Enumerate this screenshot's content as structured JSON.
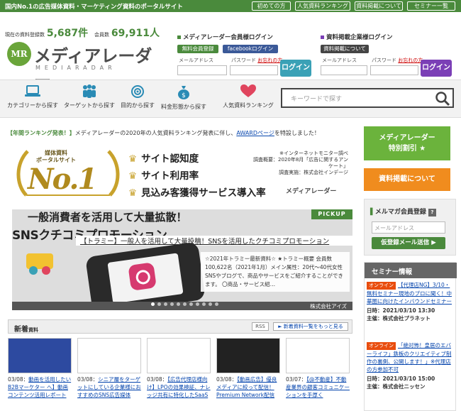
{
  "topbar": {
    "tagline": "国内No.1の広告媒体資料・マーケティング資料のポータルサイト",
    "nav": [
      "初めての方",
      "人気資料ランキング",
      "資料掲載について",
      "セミナー一覧"
    ]
  },
  "header": {
    "count_label_1": "現在の資料登録数",
    "count_value_1": "5,687件",
    "count_label_2": "会員数",
    "count_value_2": "69,911人",
    "logo_mark": "MR",
    "logo_jp": "メディアレーダー",
    "logo_en": "MEDIARADAR"
  },
  "member_login": {
    "title": "メディアレーダー会員様ログイン",
    "register_label": "無料会員登録",
    "facebook_label": "facebookログイン",
    "email_label": "メールアドレス",
    "password_label": "パスワード",
    "forgot_label": "お忘れの方",
    "login_label": "ログイン",
    "accent": "#4a8a3c",
    "button_color": "#3aa1b6"
  },
  "company_login": {
    "title": "資料掲載企業様ログイン",
    "about_label": "資料掲載について",
    "email_label": "メールアドレス",
    "password_label": "パスワード",
    "forgot_label": "お忘れの方",
    "login_label": "ログイン",
    "accent": "#7b3fb6"
  },
  "categories": [
    {
      "label": "カテゴリーから探す",
      "icon": "monitor-icon"
    },
    {
      "label": "ターゲットから探す",
      "icon": "people-icon"
    },
    {
      "label": "目的から探す",
      "icon": "target-icon"
    },
    {
      "label": "料金形態から探す",
      "icon": "moneybag-icon"
    },
    {
      "label": "人気資料ランキング",
      "icon": "heart-icon"
    }
  ],
  "search": {
    "placeholder": "キーワードで探す"
  },
  "notice": {
    "prefix": "【年間ランキング発表！】",
    "body": "メディアレーダーの2020年の人気資料ランキング発表に伴し、",
    "link": "AWARDページ",
    "suffix": "を特設しました！"
  },
  "banner": {
    "badge_sub_1": "媒体資料",
    "badge_sub_2": "ポータルサイト",
    "badge_main": "No.1",
    "line_1": "サイト認知度",
    "line_2": "サイト利用率",
    "line_3": "見込み客獲得サービス導入率",
    "note_1": "※インターネットモニター調べ",
    "note_2": "調査概要：2020年8月「広告に関するアンケート」",
    "note_3": "調査実施：株式会社インデージ",
    "logo": "メディアレーダー"
  },
  "pickup": {
    "tag": "PICKUP",
    "headline_1": "一般消費者を活用して大量拡散！",
    "headline_2": "SNSクチコミプロモーション",
    "title": "【トラミー】一般人を活用して大量投稿！SNSを活用したクチコミプロモーション",
    "description": "☆2021年トラミー最新資料☆ ★トラミー概要 会員数100,622名（2021年1月）メイン属性：20代〜40代女性 SNSやブログで、商品やサービスをご紹介することができます。 〇商品・サービス紹…",
    "company": "株式会社アイズ",
    "slide_count": 11
  },
  "new_arrivals": {
    "title": "新着",
    "title_small": "資料",
    "rss_label": "RSS",
    "more_label": "► 新着資料一覧をもっと見る",
    "items": [
      {
        "date": "03/08：",
        "title": "動画を活用したい B2Bマーケター へ】動画コンテンツ活用レポート",
        "thumb": "#2d4aa0"
      },
      {
        "date": "03/08：",
        "title": "シニア層をターゲットにしている企業様におすすめのSNS広告媒体",
        "thumb": "#ffffff"
      },
      {
        "date": "03/08：",
        "title": "【広告代理店様向け】LPOの効果検証、ナレッジ共有に特化したSaaS",
        "thumb": "#ffffff"
      },
      {
        "date": "03/08：",
        "title": "【動画広告】優良メディアに絞って配信！Premium Network配信",
        "thumb": "#222222"
      },
      {
        "date": "03/07：",
        "title": "【@不動産】不動産業界の顧客コミュニケーションを手厚く",
        "thumb": "#ffffff"
      }
    ]
  },
  "sidebar": {
    "special_line_1": "メディアレーダー",
    "special_line_2": "特別割引 ★",
    "special_color": "#6bb33c",
    "listing_label": "資料掲載について",
    "listing_color": "#f08c1e",
    "mail_title": "メルマガ会員登録",
    "mail_help": "?",
    "mail_placeholder": "メールアドレス",
    "mail_button": "仮登録メール送信 ▶",
    "seminar_title": "セミナー情報",
    "seminars": [
      {
        "tag": "オンライン",
        "title": "【代理店NG】3/10・無料セミナー現地のプロに聞く！中華圏に向けたインバウンドセミナー",
        "date": "日時：2021/03/10 13:30",
        "host": "主催：株式会社プラネット"
      },
      {
        "tag": "オンライン",
        "title": "「絶対怖！皇居のエバーライフ」鉄板のクリエイティブ制作の裏側、公開します！」※代理店の方参加不可",
        "date": "日時：2021/03/10 15:00",
        "host": "主催：株式会社ニッセン"
      }
    ]
  }
}
